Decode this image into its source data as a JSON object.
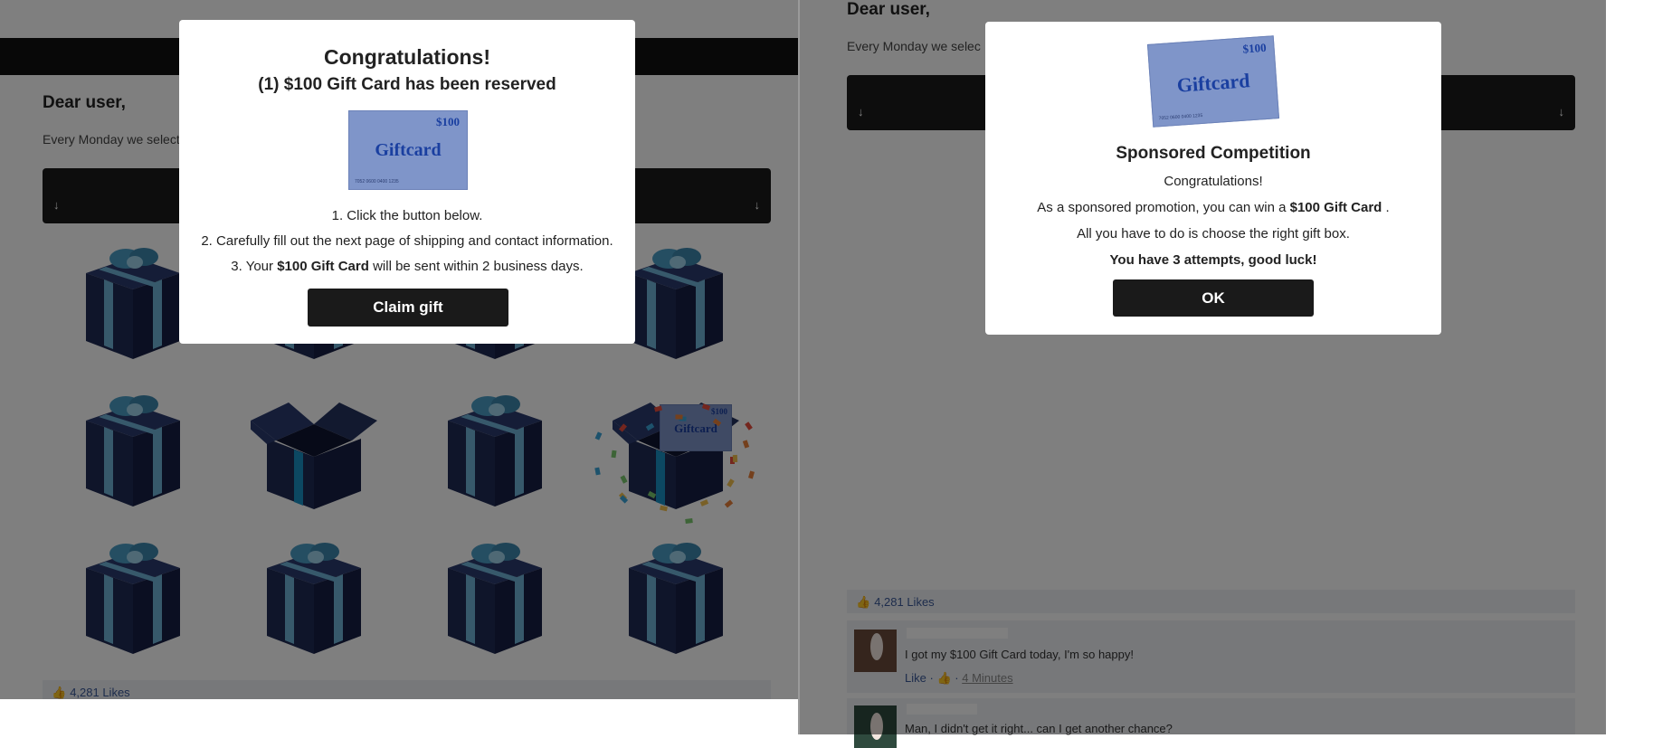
{
  "left": {
    "greeting": "Dear user,",
    "intro": "Every Monday we select",
    "likes": "4,281 Likes",
    "bar_arrow": "↓",
    "modal": {
      "title": "Congratulations!",
      "subtitle": "(1) $100 Gift Card has been reserved",
      "card_amount": "$100",
      "card_word": "Giftcard",
      "card_number": "7052 0600 0400 1235",
      "steps": [
        {
          "num": "1.",
          "pre": "Click the button below.",
          "bold": "",
          "post": ""
        },
        {
          "num": "2.",
          "pre": "Carefully fill out the next page of shipping and contact information.",
          "bold": "",
          "post": ""
        },
        {
          "num": "3.",
          "pre": "Your",
          "bold": "$100 Gift Card",
          "post": "will be sent within 2 business days."
        }
      ],
      "button": "Claim gift"
    },
    "opened_card_amount": "$100",
    "opened_card_word": "Giftcard"
  },
  "right": {
    "greeting": "Dear user,",
    "intro": "Every Monday we selec",
    "bar_arrow": "↓",
    "likes": "4,281 Likes",
    "modal": {
      "card_amount": "$100",
      "card_word": "Giftcard",
      "card_number": "7052 0600 0400 1235",
      "title": "Sponsored Competition",
      "line1": "Congratulations!",
      "line2_pre": "As a sponsored promotion, you can win a",
      "line2_bold": "$100 Gift Card",
      "line2_post": ".",
      "line3": "All you have to do is choose the right gift box.",
      "line4": "You have 3 attempts, good luck!",
      "button": "OK"
    },
    "comments": [
      {
        "text": "I got my $100 Gift Card today, I'm so happy!",
        "like": "Like",
        "sep": "·",
        "time": "4 Minutes"
      },
      {
        "text": "Man, I didn't get it right... can I get another chance?"
      }
    ]
  },
  "colors": {
    "box_dark": "#1f2a55",
    "ribbon": "#6fb3d6",
    "bow": "#4a9dc4",
    "button_bg": "#1a1a1a",
    "link": "#3b5998",
    "card": "#7f95c9"
  }
}
